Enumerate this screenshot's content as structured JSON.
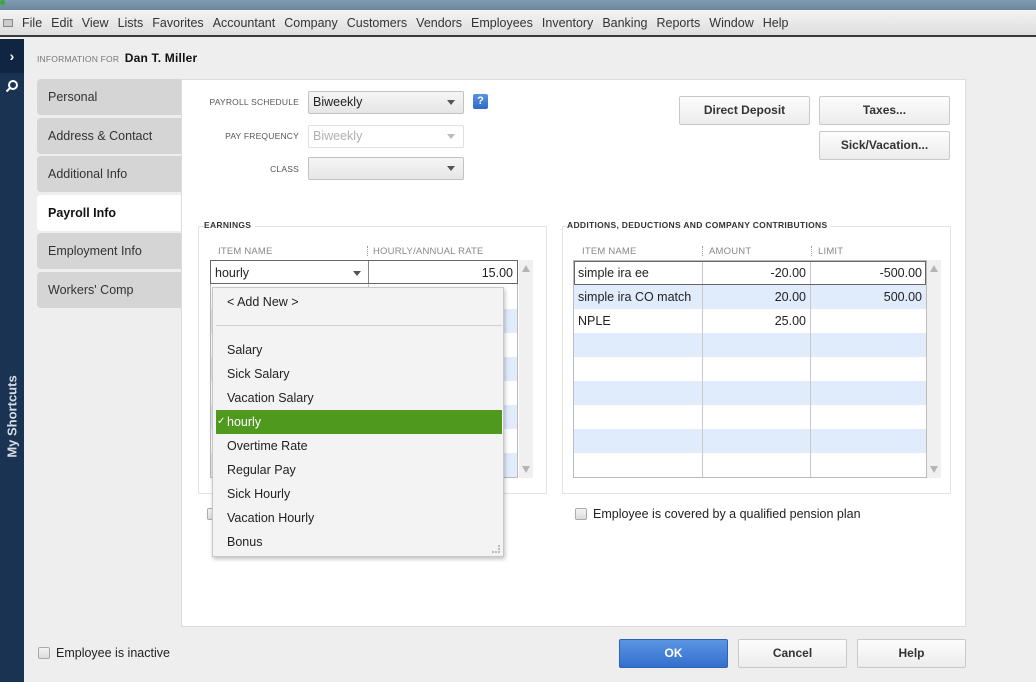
{
  "menubar": {
    "items": [
      {
        "label": "File"
      },
      {
        "label": "Edit"
      },
      {
        "label": "View"
      },
      {
        "label": "Lists"
      },
      {
        "label": "Favorites"
      },
      {
        "label": "Accountant"
      },
      {
        "label": "Company"
      },
      {
        "label": "Customers"
      },
      {
        "label": "Vendors"
      },
      {
        "label": "Employees"
      },
      {
        "label": "Inventory"
      },
      {
        "label": "Banking"
      },
      {
        "label": "Reports"
      },
      {
        "label": "Window"
      },
      {
        "label": "Help"
      }
    ]
  },
  "sidebar": {
    "expand_icon": "chevron-right-icon",
    "search_icon": "search-icon",
    "label": "My Shortcuts"
  },
  "header": {
    "info_for_label": "INFORMATION FOR",
    "employee_name": "Dan T. Miller"
  },
  "tabs": [
    {
      "label": "Personal",
      "active": false
    },
    {
      "label": "Address & Contact",
      "active": false
    },
    {
      "label": "Additional Info",
      "active": false
    },
    {
      "label": "Payroll Info",
      "active": true
    },
    {
      "label": "Employment Info",
      "active": false
    },
    {
      "label": "Workers' Comp",
      "active": false
    }
  ],
  "payroll": {
    "schedule_label": "PAYROLL SCHEDULE",
    "schedule_value": "Biweekly",
    "help_label": "?",
    "frequency_label": "PAY FREQUENCY",
    "frequency_value": "Biweekly",
    "class_label": "CLASS",
    "class_value": ""
  },
  "buttons": {
    "direct_deposit": "Direct Deposit",
    "taxes": "Taxes...",
    "sick_vacation": "Sick/Vacation...",
    "ok": "OK",
    "cancel": "Cancel",
    "help": "Help"
  },
  "earnings": {
    "title": "EARNINGS",
    "columns": [
      "ITEM NAME",
      "HOURLY/ANNUAL RATE"
    ],
    "current_row": {
      "item": "hourly",
      "rate": "15.00"
    }
  },
  "item_dropdown": {
    "add_new": "< Add New >",
    "options": [
      "Salary",
      "Sick Salary",
      "Vacation Salary",
      "hourly",
      "Overtime Rate",
      "Regular Pay",
      "Sick Hourly",
      "Vacation Hourly",
      "Bonus"
    ],
    "selected": "hourly",
    "selected_color": "#4f9a1e"
  },
  "additions": {
    "title": "ADDITIONS, DEDUCTIONS AND COMPANY CONTRIBUTIONS",
    "columns": [
      "ITEM NAME",
      "AMOUNT",
      "LIMIT"
    ],
    "rows": [
      {
        "item": "simple ira ee",
        "amount": "-20.00",
        "limit": "-500.00"
      },
      {
        "item": "simple ira CO match",
        "amount": "20.00",
        "limit": "500.00"
      },
      {
        "item": "NPLE",
        "amount": "25.00",
        "limit": ""
      }
    ]
  },
  "checkboxes": {
    "pension_plan": {
      "label": "Employee is covered by a qualified pension plan",
      "checked": false
    },
    "inactive": {
      "label": "Employee is inactive",
      "checked": false
    }
  },
  "colors": {
    "primary_button": "#3a75d4",
    "selected_item": "#4f9a1e",
    "sidebar": "#1b3352"
  }
}
